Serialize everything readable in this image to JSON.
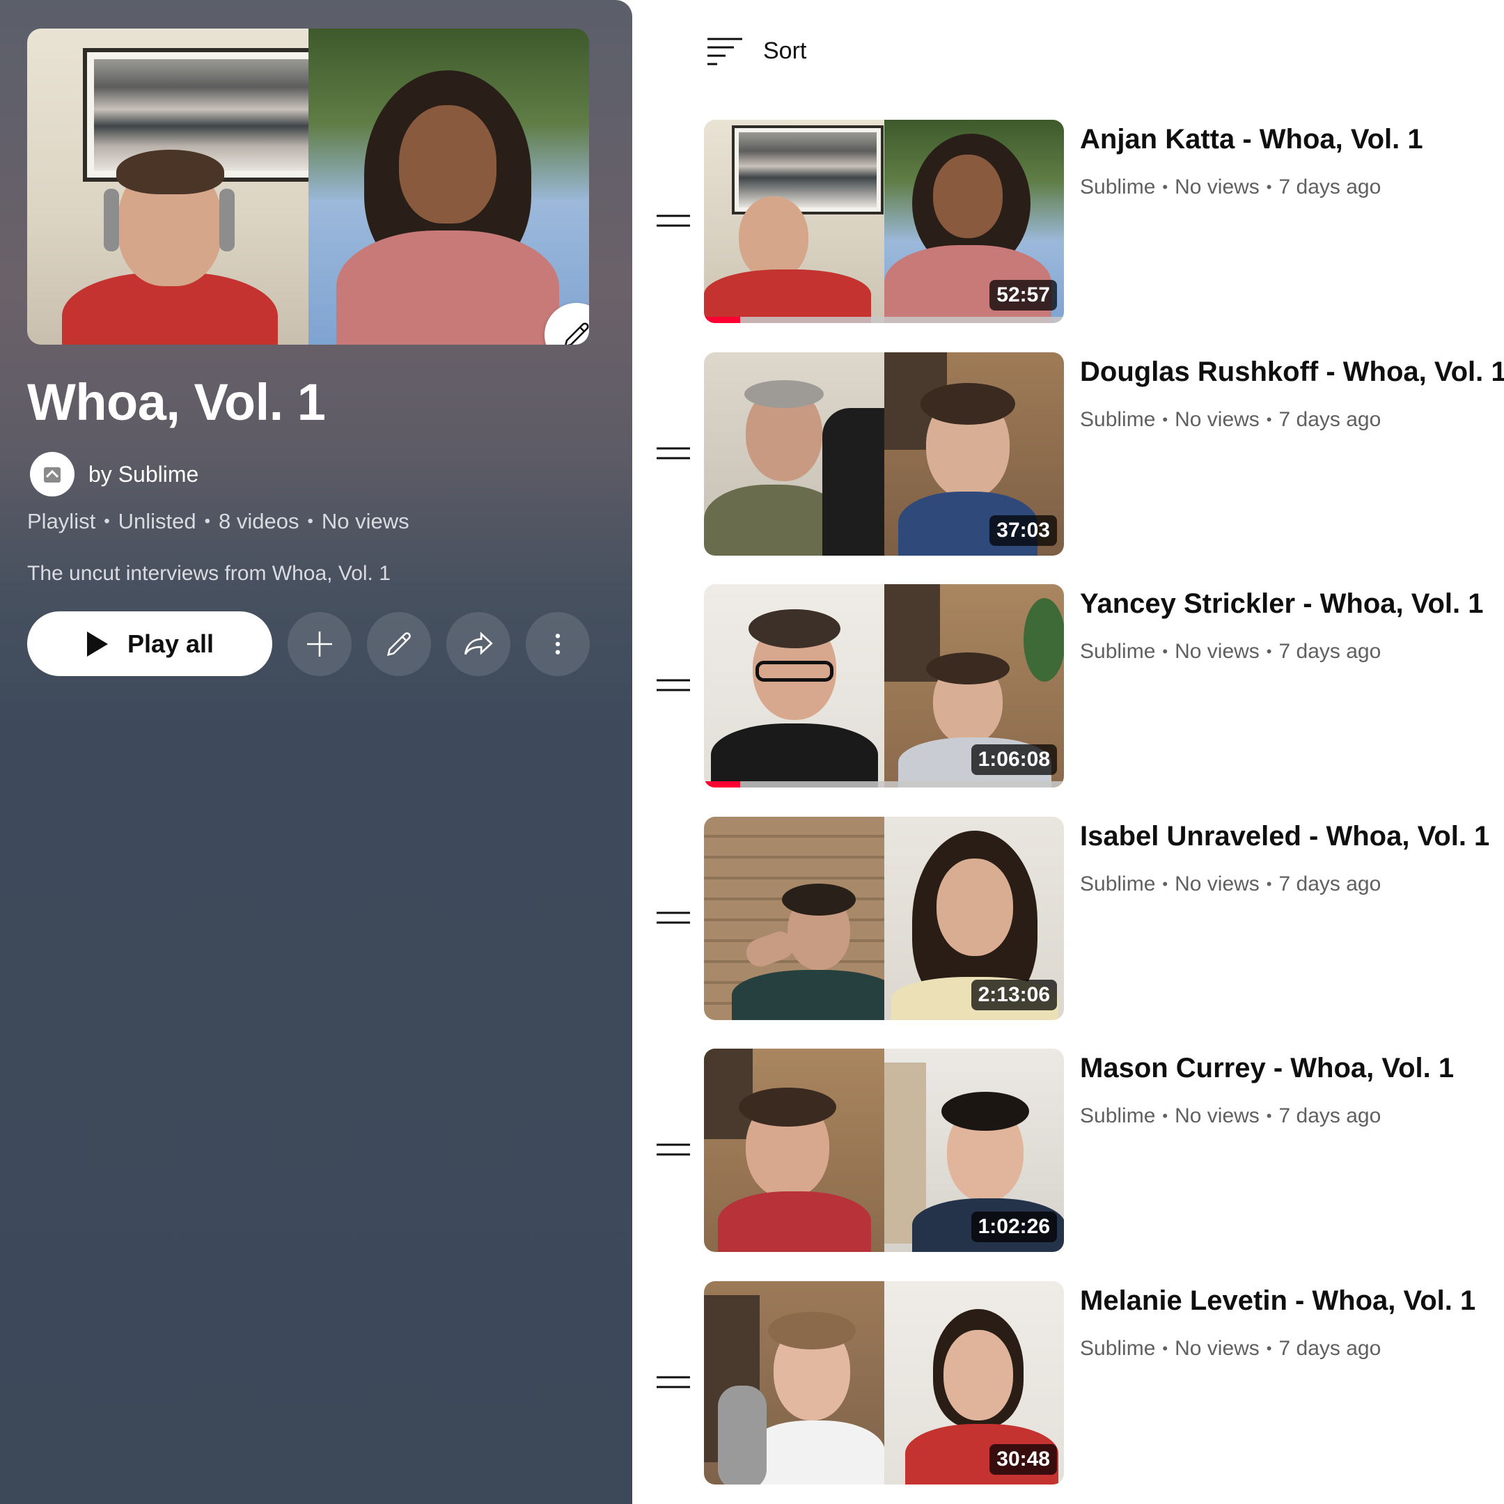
{
  "playlist": {
    "title": "Whoa, Vol. 1",
    "owner": "by Sublime",
    "meta": [
      "Playlist",
      "Unlisted",
      "8 videos",
      "No views"
    ],
    "description": "The uncut interviews from Whoa, Vol. 1",
    "play_all_label": "Play all",
    "icons": {
      "edit_thumbnail": "pencil-icon",
      "add": "plus-icon",
      "edit": "pencil-icon",
      "share": "share-icon",
      "more": "more-vert-icon",
      "avatar": "sublime-logo"
    }
  },
  "sort": {
    "label": "Sort",
    "icon": "sort-icon"
  },
  "videos": [
    {
      "title": "Anjan Katta - Whoa, Vol. 1",
      "channel": "Sublime",
      "views": "No views",
      "age": "7 days ago",
      "duration": "52:57",
      "progress": 0.1
    },
    {
      "title": "Douglas Rushkoff - Whoa, Vol. 1",
      "channel": "Sublime",
      "views": "No views",
      "age": "7 days ago",
      "duration": "37:03",
      "progress": 0
    },
    {
      "title": "Yancey Strickler - Whoa, Vol. 1",
      "channel": "Sublime",
      "views": "No views",
      "age": "7 days ago",
      "duration": "1:06:08",
      "progress": 0.1
    },
    {
      "title": "Isabel Unraveled - Whoa, Vol. 1",
      "channel": "Sublime",
      "views": "No views",
      "age": "7 days ago",
      "duration": "2:13:06",
      "progress": 0
    },
    {
      "title": "Mason Currey - Whoa, Vol. 1",
      "channel": "Sublime",
      "views": "No views",
      "age": "7 days ago",
      "duration": "1:02:26",
      "progress": 0
    },
    {
      "title": "Melanie Levetin - Whoa, Vol. 1",
      "channel": "Sublime",
      "views": "No views",
      "age": "7 days ago",
      "duration": "30:48",
      "progress": 0
    }
  ],
  "colors": {
    "accent_red": "#ff0033",
    "panel_dark": "#3d4959",
    "text_primary": "#0f0f0f",
    "text_secondary": "#606060"
  }
}
